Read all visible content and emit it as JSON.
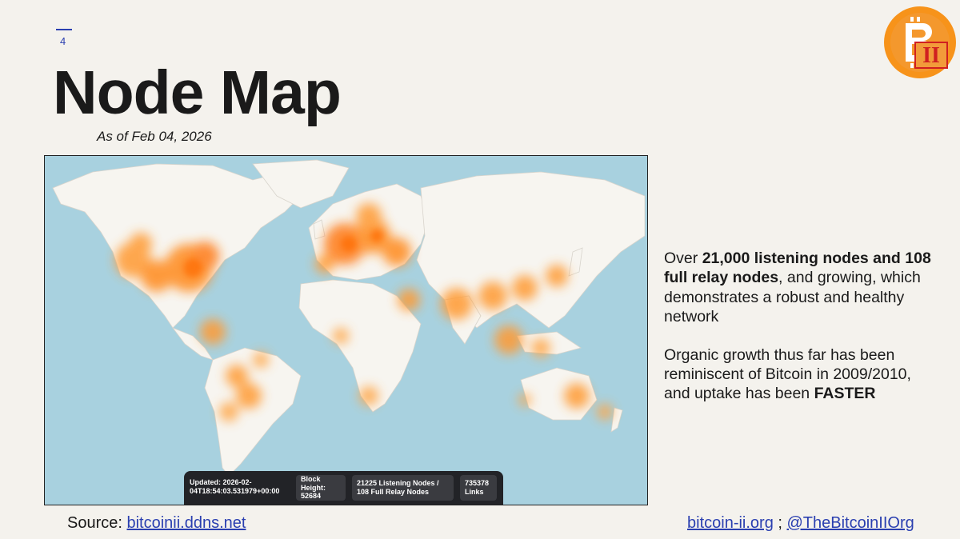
{
  "slide": {
    "number": "4",
    "title": "Node Map",
    "subtitle": "As of Feb 04, 2026"
  },
  "logo": {
    "text": "II",
    "colors": {
      "outer": "#f7931a",
      "inner": "#e96b12",
      "mark": "#ffffff",
      "accent": "#d02020"
    }
  },
  "map": {
    "colors": {
      "ocean": "#a8d1df",
      "land": "#f7f5f0",
      "heat": "#ff8a1e",
      "heat_core": "#ff6a00"
    },
    "status_bar": {
      "updated": "Updated: 2026-02-\n04T18:54:03.531979+00:00",
      "block_height": "Block\nHeight:\n52684",
      "nodes": "21225 Listening Nodes /\n108 Full Relay Nodes",
      "links": "735378\nLinks"
    }
  },
  "side_text": {
    "p1_prefix": "Over ",
    "p1_bold": "21,000 listening nodes and 108 full relay nodes",
    "p1_suffix": ", and growing, which demonstrates a robust and healthy network",
    "p2_prefix": "Organic growth thus far has been reminiscent of Bitcoin in 2009/2010, and uptake has been ",
    "p2_bold": "FASTER"
  },
  "footer": {
    "source_label": "Source: ",
    "source_link": "bitcoinii.ddns.net",
    "site_link": "bitcoin-ii.org",
    "separator": " ; ",
    "twitter_link": "@TheBitcoinIIOrg"
  },
  "colors": {
    "accent": "#2a3fb0",
    "background": "#f4f2ed"
  }
}
